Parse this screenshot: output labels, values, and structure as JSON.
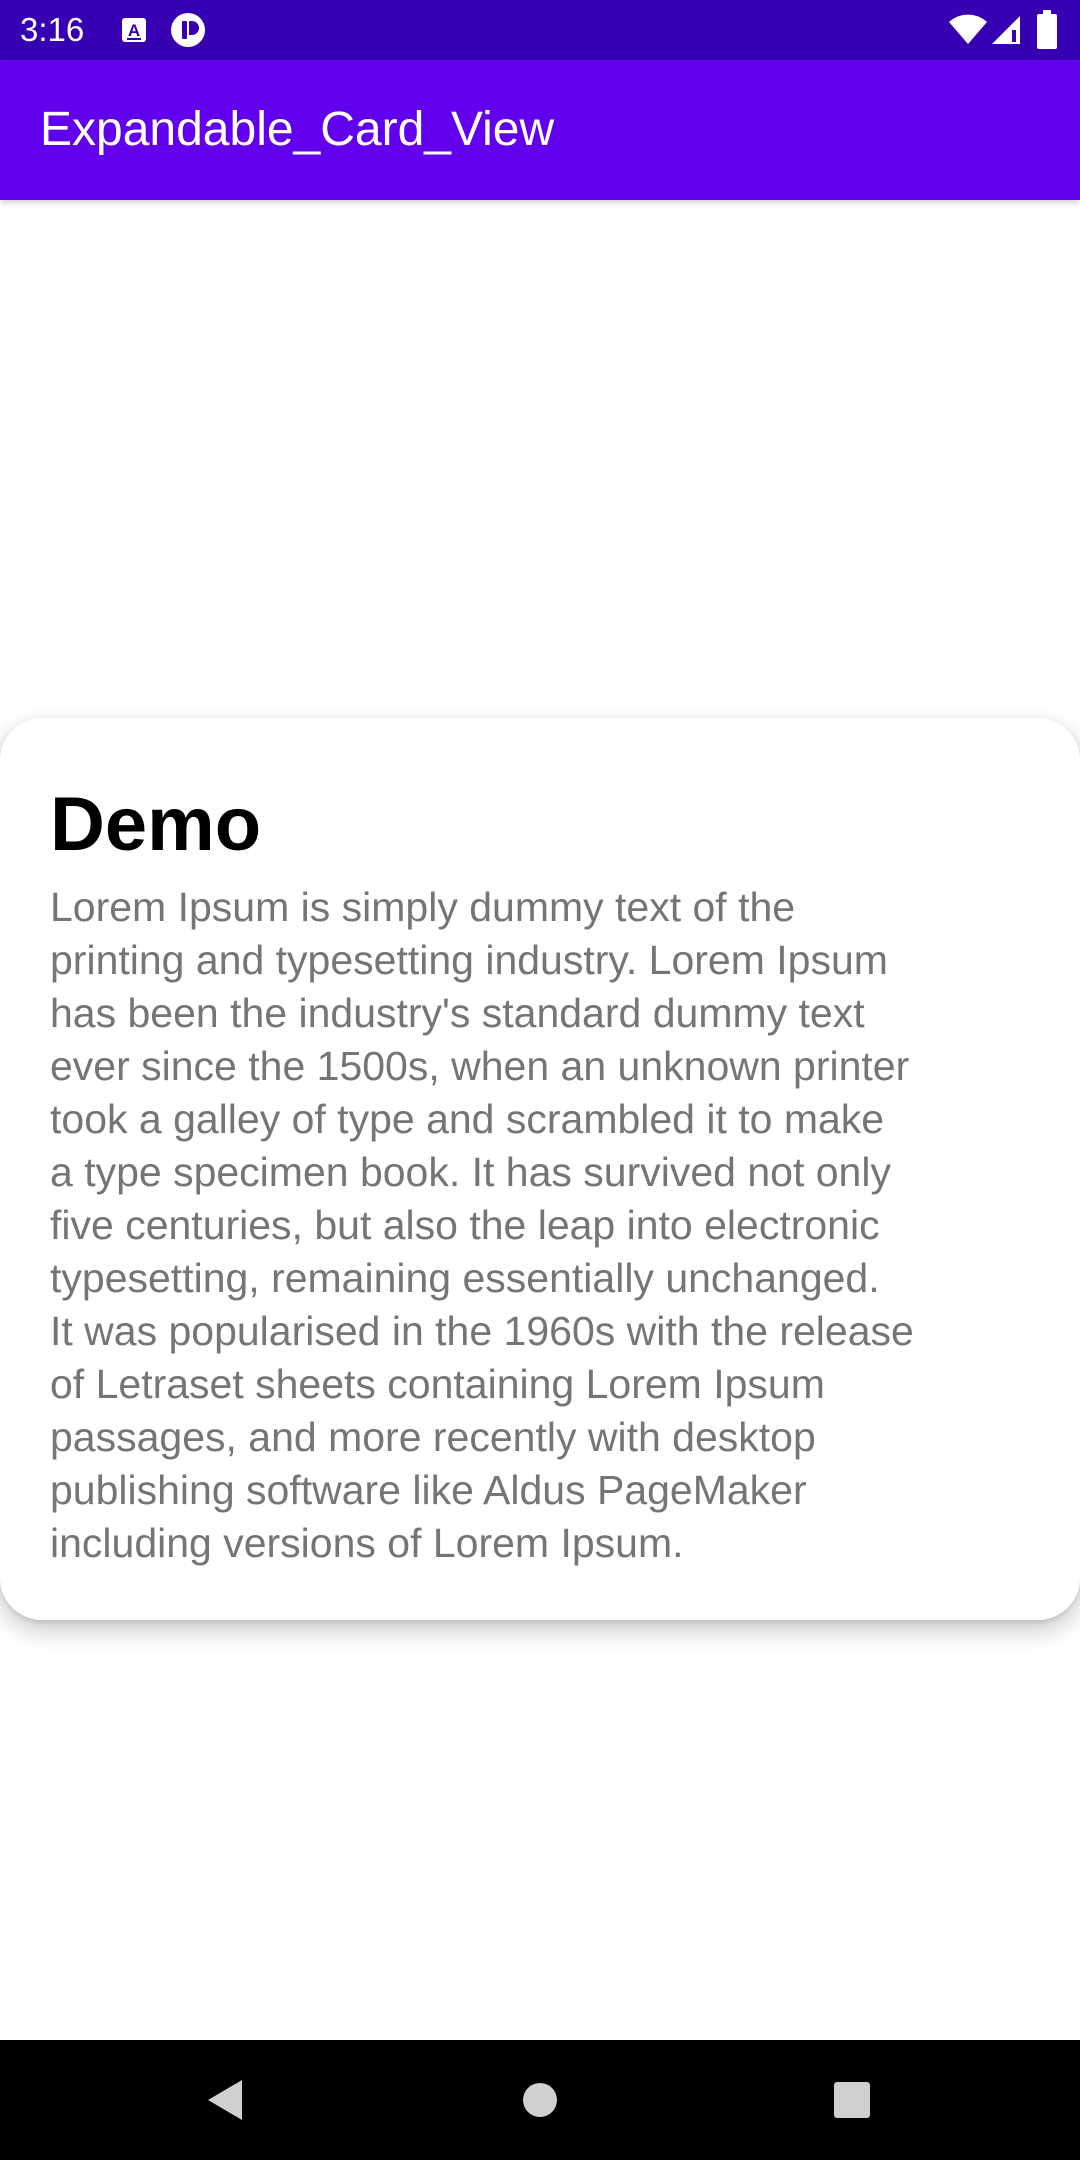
{
  "status_bar": {
    "time": "3:16",
    "icons_left": [
      "accessibility-a-icon",
      "record-icon"
    ],
    "icons_right": [
      "wifi-icon",
      "signal-icon",
      "battery-icon"
    ],
    "background": "#3700b3"
  },
  "app_bar": {
    "title": "Expandable_Card_View",
    "background": "#6200ee"
  },
  "card": {
    "title": "Demo",
    "body": "Lorem Ipsum is simply dummy text of the\nprinting and typesetting industry. Lorem Ipsum\nhas been the industry's standard dummy text\never since the 1500s, when an unknown printer\ntook a galley of type and scrambled it to make\na type specimen book. It has survived not only\nfive centuries, but also the leap into electronic\ntypesetting, remaining essentially unchanged.\nIt was popularised in the 1960s with the release\nof Letraset sheets containing Lorem Ipsum\npassages, and more recently with desktop\npublishing software like Aldus PageMaker\nincluding versions of Lorem Ipsum.",
    "body_color": "#757575"
  },
  "nav_bar": {
    "buttons": [
      "back-icon",
      "home-icon",
      "recents-icon"
    ]
  }
}
